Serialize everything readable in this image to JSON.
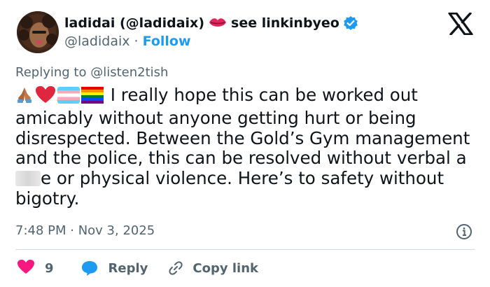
{
  "header": {
    "display_name": "ladidai (@ladidaix)",
    "bio_link_text": "see linkinbyeo",
    "handle": "@ladidaix",
    "separator": "·",
    "follow_label": "Follow"
  },
  "reply_context": {
    "prefix": "Replying to",
    "mention": "@listen2tish"
  },
  "tweet": {
    "text_part1": " I really hope this can be worked out amicably without anyone getting hurt or being disrespected. Between the Gold’s Gym management and the police, this can be resolved without verbal a",
    "text_part2": "e or physical violence. Here’s to safety without bigotry."
  },
  "meta": {
    "timestamp": "7:48 PM · Nov 3, 2025"
  },
  "actions": {
    "like_count": "9",
    "reply_label": "Reply",
    "copy_label": "Copy link"
  },
  "icons": {
    "lips": "lips-icon",
    "verified": "verified-badge-icon",
    "x_logo": "x-logo-icon",
    "info": "info-icon",
    "heart": "heart-icon",
    "reply": "reply-bubble-icon",
    "link": "link-icon"
  },
  "colors": {
    "accent": "#1d9bf0",
    "like": "#f91880",
    "muted": "#536471",
    "text": "#0f1419"
  }
}
